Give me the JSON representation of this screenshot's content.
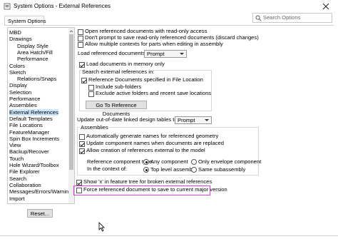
{
  "window": {
    "title": "System Options - External References",
    "search_placeholder": "Search Options"
  },
  "tabs": [
    "System Options"
  ],
  "tree": [
    {
      "label": "MBD",
      "indent": 0
    },
    {
      "label": "Drawings",
      "indent": 0
    },
    {
      "label": "Display Style",
      "indent": 1
    },
    {
      "label": "Area Hatch/Fill",
      "indent": 1
    },
    {
      "label": "Performance",
      "indent": 1
    },
    {
      "label": "Colors",
      "indent": 0
    },
    {
      "label": "Sketch",
      "indent": 0
    },
    {
      "label": "Relations/Snaps",
      "indent": 1
    },
    {
      "label": "Display",
      "indent": 0
    },
    {
      "label": "Selection",
      "indent": 0
    },
    {
      "label": "Performance",
      "indent": 0
    },
    {
      "label": "Assemblies",
      "indent": 0
    },
    {
      "label": "External References",
      "indent": 0
    },
    {
      "label": "Default Templates",
      "indent": 0
    },
    {
      "label": "File Locations",
      "indent": 0
    },
    {
      "label": "FeatureManager",
      "indent": 0
    },
    {
      "label": "Spin Box Increments",
      "indent": 0
    },
    {
      "label": "View",
      "indent": 0
    },
    {
      "label": "Backup/Recover",
      "indent": 0
    },
    {
      "label": "Touch",
      "indent": 0
    },
    {
      "label": "Hole Wizard/Toolbox",
      "indent": 0
    },
    {
      "label": "File Explorer",
      "indent": 0
    },
    {
      "label": "Search",
      "indent": 0
    },
    {
      "label": "Collaboration",
      "indent": 0
    },
    {
      "label": "Messages/Errors/Warnings",
      "indent": 0
    },
    {
      "label": "Import",
      "indent": 0
    }
  ],
  "reset_label": "Reset...",
  "options": {
    "open_read_only": "Open referenced documents with read-only access",
    "dont_prompt_save": "Don't prompt to save read-only referenced documents (discard changes)",
    "allow_multiple_contexts": "Allow multiple contexts for parts when editing in assembly",
    "load_ref_docs_label": "Load referenced documents:",
    "load_ref_docs_value": "Prompt",
    "load_in_memory": "Load documents in memory only",
    "search_ext_refs_title": "Search external references in:",
    "ref_docs_file_location": "Reference Documents specified in File Location",
    "include_subfolders": "Include sub-folders",
    "exclude_active_folders": "Exclude active folders and recent save locations",
    "go_to_ref_docs": "Go To Reference Documents",
    "update_linked_tables_label": "Update out-of-date linked design tables to:",
    "update_linked_tables_value": "Prompt",
    "assemblies_title": "Assemblies",
    "auto_generate_names": "Automatically generate names for referenced geometry",
    "update_component_names": "Update component names when documents are replaced",
    "allow_creation_ext_refs": "Allow creation of references external to the model",
    "ref_component_type_label": "Reference component type:",
    "any_component": "Any component",
    "only_envelope": "Only envelope component",
    "in_context_label": "In the context of:",
    "top_level_assembly": "Top level assembly",
    "same_subassembly": "Same subassembly",
    "show_x_tree": "Show 'x' in feature tree for broken external references",
    "force_save_current": "Force referenced document to save to current major version"
  },
  "states": {
    "open_read_only": false,
    "dont_prompt_save": false,
    "allow_multiple_contexts": false,
    "load_in_memory": true,
    "ref_docs_file_location": true,
    "include_subfolders": false,
    "exclude_active_folders": false,
    "auto_generate_names": false,
    "update_component_names": true,
    "allow_creation_ext_refs": true,
    "ref_component_type": "Any component",
    "in_context": "Top level assembly",
    "show_x_tree": true,
    "force_save_current": false
  },
  "colors": {
    "highlight_border": "#e040e0",
    "tree_selection": "#cce8ff"
  }
}
